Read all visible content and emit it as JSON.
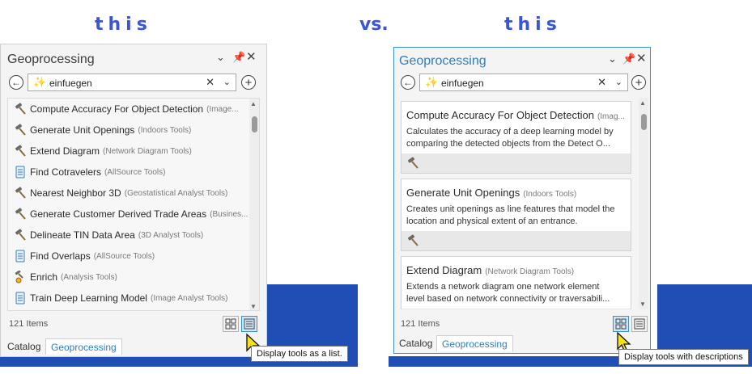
{
  "captions": {
    "left": "this",
    "mid": "vs.",
    "right": "this"
  },
  "panel_title": "Geoprocessing",
  "search_value": "einfuegen",
  "items_count": "121 Items",
  "tabs": {
    "catalog": "Catalog",
    "geoprocessing": "Geoprocessing"
  },
  "list_items": [
    {
      "name": "Compute Accuracy For Object Detection",
      "toolbox": "(Image...",
      "icon": "hammer"
    },
    {
      "name": "Generate Unit Openings",
      "toolbox": "(Indoors Tools)",
      "icon": "hammer"
    },
    {
      "name": "Extend Diagram",
      "toolbox": "(Network Diagram Tools)",
      "icon": "hammer"
    },
    {
      "name": "Find Cotravelers",
      "toolbox": "(AllSource Tools)",
      "icon": "script"
    },
    {
      "name": "Nearest Neighbor 3D",
      "toolbox": "(Geostatistical Analyst Tools)",
      "icon": "hammer"
    },
    {
      "name": "Generate Customer Derived Trade Areas",
      "toolbox": "(Busines...",
      "icon": "hammer"
    },
    {
      "name": "Delineate TIN Data Area",
      "toolbox": "(3D Analyst Tools)",
      "icon": "hammer"
    },
    {
      "name": "Find Overlaps",
      "toolbox": "(AllSource Tools)",
      "icon": "script"
    },
    {
      "name": "Enrich",
      "toolbox": "(Analysis Tools)",
      "icon": "enrich"
    },
    {
      "name": "Train Deep Learning Model",
      "toolbox": "(Image Analyst Tools)",
      "icon": "script"
    }
  ],
  "cards": [
    {
      "name": "Compute Accuracy For Object Detection",
      "toolbox": "(Imag...",
      "desc": "Calculates the accuracy of a deep learning model by\ncomparing the detected objects from the Detect O..."
    },
    {
      "name": "Generate Unit Openings",
      "toolbox": "(Indoors Tools)",
      "desc": "Creates unit openings as line features that model the\nlocation and physical extent of an entrance."
    },
    {
      "name": "Extend Diagram",
      "toolbox": "(Network Diagram Tools)",
      "desc": "Extends a network diagram one network element\nlevel based on network connectivity or traversabili..."
    }
  ],
  "tooltips": {
    "list": "Display tools as a list.",
    "desc": "Display tools with descriptions"
  },
  "colors": {
    "accent": "#2f7dbf",
    "caption": "#3b55d6",
    "desktop": "#1f4fb5"
  }
}
